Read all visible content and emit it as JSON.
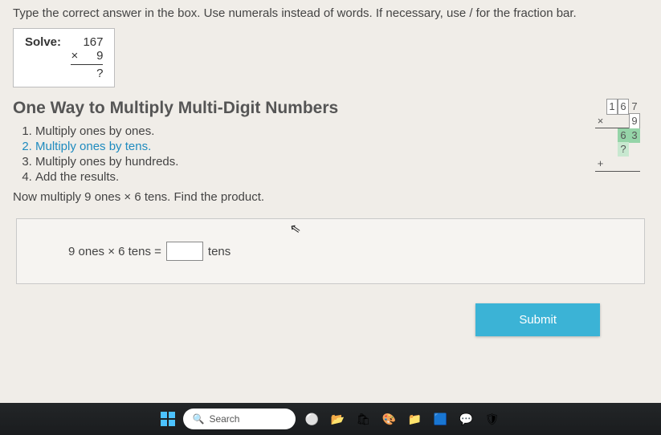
{
  "instruction": "Type the correct answer in the box. Use numerals instead of words. If necessary, use / for the fraction bar.",
  "solve": {
    "label": "Solve:",
    "multiplicand": "167",
    "op": "×",
    "multiplier": "9",
    "result": "?"
  },
  "heading": "One Way to Multiply Multi-Digit Numbers",
  "steps": [
    "Multiply ones by ones.",
    "Multiply ones by tens.",
    "Multiply ones by hundreds.",
    "Add the results."
  ],
  "active_step_index": 1,
  "prompt": "Now multiply 9 ones × 6 tens. Find the product.",
  "mini": {
    "top_d1": "1",
    "top_d2": "6",
    "top_d3": "7",
    "op": "×",
    "mult_d3": "9",
    "p1_d2": "6",
    "p1_d3": "3",
    "p2_placeholder": "?",
    "plus": "+"
  },
  "equation": {
    "lhs": "9 ones × 6 tens =",
    "unit": "tens",
    "value": "",
    "placeholder": ""
  },
  "submit_label": "Submit",
  "taskbar": {
    "search_placeholder": "Search"
  },
  "icons": {
    "cursor": "⇖",
    "magnifier": "🔍",
    "circle": "⚪",
    "folder": "📁",
    "store": "🛍",
    "paint": "🎨",
    "edge": "🟦",
    "files": "📂",
    "chat": "💬",
    "settings": "⚙",
    "shield": "🛡"
  }
}
